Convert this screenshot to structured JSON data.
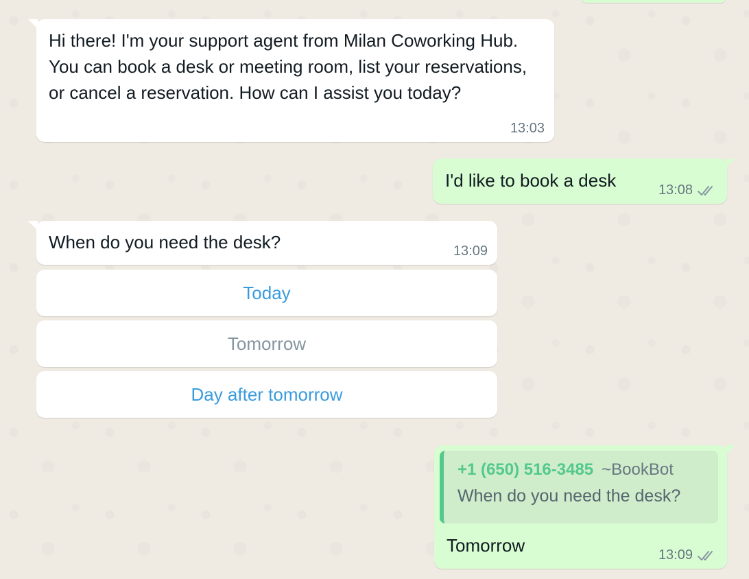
{
  "messages": {
    "m1": {
      "text": "Hi there! I'm your support agent from Milan Coworking Hub. You can book a desk or meeting room, list your reservations, or cancel a reservation. How can I assist you today?",
      "time": "13:03"
    },
    "m2": {
      "text": "I'd like to book a desk",
      "time": "13:08"
    },
    "m3": {
      "text": "When do you need the desk?",
      "time": "13:09"
    },
    "m4": {
      "quote_phone": "+1 (650) 516-3485",
      "quote_name": "~BookBot",
      "quote_text": "When do you need the desk?",
      "text": "Tomorrow",
      "time": "13:09"
    }
  },
  "options": [
    {
      "label": "Today",
      "state": "active"
    },
    {
      "label": "Tomorrow",
      "state": "disabled"
    },
    {
      "label": "Day after tomorrow",
      "state": "active"
    }
  ],
  "colors": {
    "background": "#efeae2",
    "incoming_bubble": "#ffffff",
    "outgoing_bubble": "#d9fdd3",
    "option_active": "#3a9bdc",
    "option_disabled": "#8696a0",
    "quote_accent": "#53c98b",
    "tick": "#8696a0"
  },
  "icons": {
    "read_receipt": "double-check-icon"
  }
}
